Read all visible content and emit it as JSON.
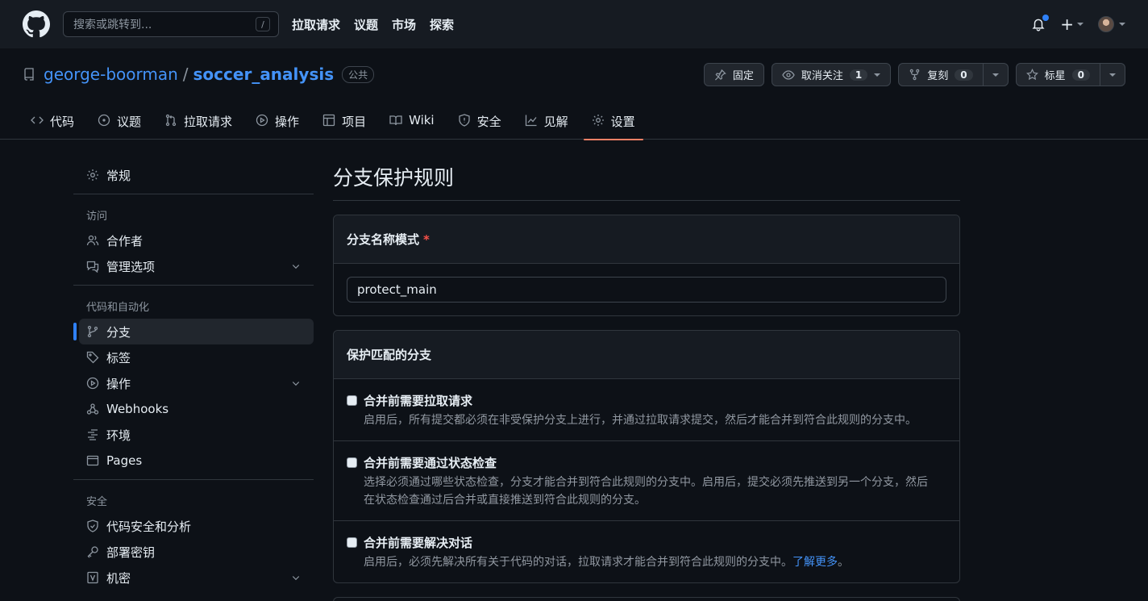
{
  "header": {
    "search_placeholder": "搜索或跳转到...",
    "search_key": "/",
    "nav": [
      "拉取请求",
      "议题",
      "市场",
      "探索"
    ],
    "plus": "+"
  },
  "repo": {
    "owner": "george-boorman",
    "separator": "/",
    "name": "soccer_analysis",
    "visibility": "公共",
    "actions": {
      "pin_label": "固定",
      "unwatch_label": "取消关注",
      "watch_count": "1",
      "fork_label": "复刻",
      "fork_count": "0",
      "star_label": "标星",
      "star_count": "0"
    },
    "tabs": [
      "代码",
      "议题",
      "拉取请求",
      "操作",
      "项目",
      "Wiki",
      "安全",
      "见解",
      "设置"
    ]
  },
  "sidebar": {
    "general": "常规",
    "access_heading": "访问",
    "collaborators": "合作者",
    "moderation": "管理选项",
    "automation_heading": "代码和自动化",
    "branches": "分支",
    "tags": "标签",
    "actions": "操作",
    "webhooks": "Webhooks",
    "environments": "环境",
    "pages": "Pages",
    "security_heading": "安全",
    "code_security": "代码安全和分析",
    "deploy_keys": "部署密钥",
    "secrets": "机密"
  },
  "content": {
    "title": "分支保护规则",
    "pattern_label": "分支名称模式",
    "required_mark": "*",
    "pattern_value": "protect_main",
    "protect_heading": "保护匹配的分支",
    "options": [
      {
        "title": "合并前需要拉取请求",
        "desc": "启用后，所有提交都必须在非受保护分支上进行，并通过拉取请求提交，然后才能合并到符合此规则的分支中。"
      },
      {
        "title": "合并前需要通过状态检查",
        "desc": "选择必须通过哪些状态检查，分支才能合并到符合此规则的分支中。启用后，提交必须先推送到另一个分支，然后在状态检查通过后合并或直接推送到符合此规则的分支。"
      },
      {
        "title": "合并前需要解决对话",
        "desc": "启用后，必须先解决所有关于代码的对话，拉取请求才能合并到符合此规则的分支中。",
        "link": "了解更多",
        "tail": "。"
      }
    ]
  },
  "colors": {
    "accent": "#2f81f7",
    "tab_underline": "#f78166",
    "required": "#f85149"
  }
}
